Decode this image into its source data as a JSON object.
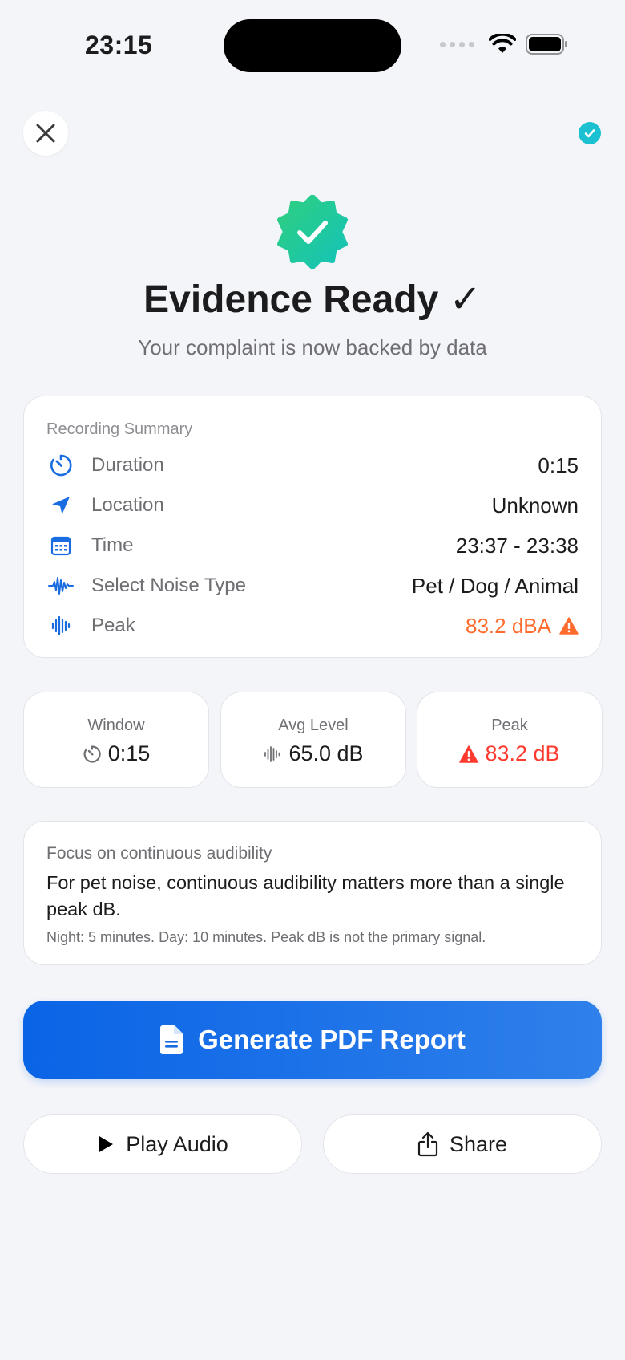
{
  "status_bar": {
    "time": "23:15"
  },
  "header": {
    "title": "Evidence Ready ✓",
    "subtitle": "Your complaint is now backed by data"
  },
  "summary": {
    "label": "Recording Summary",
    "rows": [
      {
        "icon": "timer-icon",
        "label": "Duration",
        "value": "0:15"
      },
      {
        "icon": "location-arrow-icon",
        "label": "Location",
        "value": "Unknown"
      },
      {
        "icon": "calendar-icon",
        "label": "Time",
        "value": "23:37 - 23:38"
      },
      {
        "icon": "waveform-icon",
        "label": "Select Noise Type",
        "value": "Pet / Dog / Animal"
      },
      {
        "icon": "waveform-icon",
        "label": "Peak",
        "value": "83.2 dBA"
      }
    ]
  },
  "stats": [
    {
      "label": "Window",
      "value": "0:15",
      "icon": "timer-icon"
    },
    {
      "label": "Avg Level",
      "value": "65.0 dB",
      "icon": "waveform-icon"
    },
    {
      "label": "Peak",
      "value": "83.2 dB",
      "icon": "warning-icon"
    }
  ],
  "focus": {
    "title": "Focus on continuous audibility",
    "body": "For pet noise, continuous audibility matters more than a single peak dB.",
    "note": "Night: 5 minutes. Day: 10 minutes. Peak dB is not the primary signal."
  },
  "actions": {
    "generate_label": "Generate PDF Report",
    "play_label": "Play Audio",
    "share_label": "Share"
  },
  "colors": {
    "accent": "#0a64e6",
    "warning_orange": "#ff6b2c",
    "alert_red": "#ff3b30",
    "badge_green": "#1fc79a",
    "check_teal": "#1cc1d1"
  }
}
